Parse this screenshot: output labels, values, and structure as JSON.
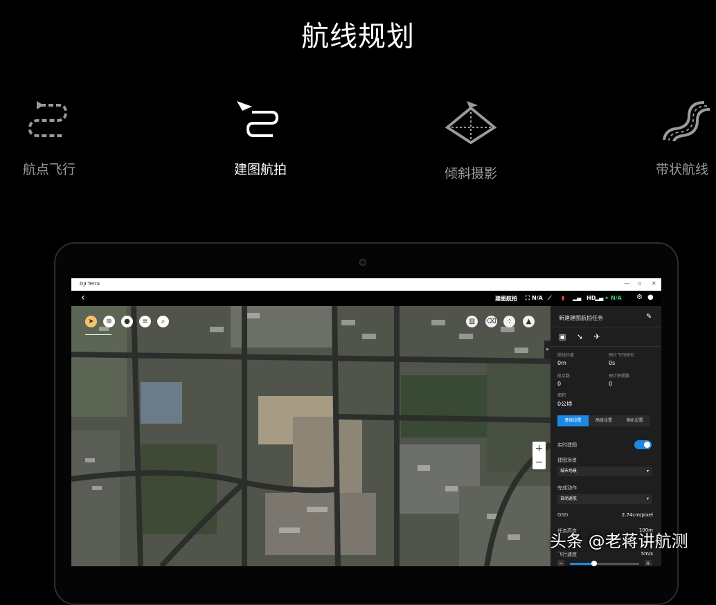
{
  "hero": {
    "title": "航线规划"
  },
  "modes": [
    {
      "label": "航点飞行",
      "icon": "waypoint-flight-icon"
    },
    {
      "label": "建图航拍",
      "icon": "mapping-flight-icon"
    },
    {
      "label": "倾斜摄影",
      "icon": "oblique-photography-icon"
    },
    {
      "label": "带状航线",
      "icon": "corridor-route-icon"
    }
  ],
  "app": {
    "window_title": "DJI Terra",
    "topbar": {
      "mode_label": "建图航拍",
      "status_1": "N/A",
      "hd": "HD",
      "status_2": "N/A"
    },
    "panel": {
      "title": "新建建图航拍任务",
      "stats": [
        {
          "label": "航线长度",
          "value": "0m"
        },
        {
          "label": "预计飞行时间",
          "value": "0s"
        },
        {
          "label": "航点数",
          "value": "0"
        },
        {
          "label": "预计拍照数",
          "value": "0"
        },
        {
          "label": "面积",
          "value": "0公顷"
        }
      ],
      "tabs": [
        "基础设置",
        "高级设置",
        "相机设置"
      ],
      "realtime_label": "实时建图",
      "scene_label": "建图场景",
      "scene_value": "城市场景",
      "finish_label": "完成动作",
      "finish_value": "自动返航",
      "gsd_label": "GSD",
      "gsd_value": "2.74cm/pixel",
      "altitude_label": "任务高度",
      "altitude_value": "100m",
      "speed_label": "飞行速度",
      "speed_value": "5m/s",
      "speed_level": 0.35
    },
    "map": {
      "zoom_in": "+",
      "zoom_out": "−"
    }
  },
  "watermark": "头条 @老蒋讲航测"
}
